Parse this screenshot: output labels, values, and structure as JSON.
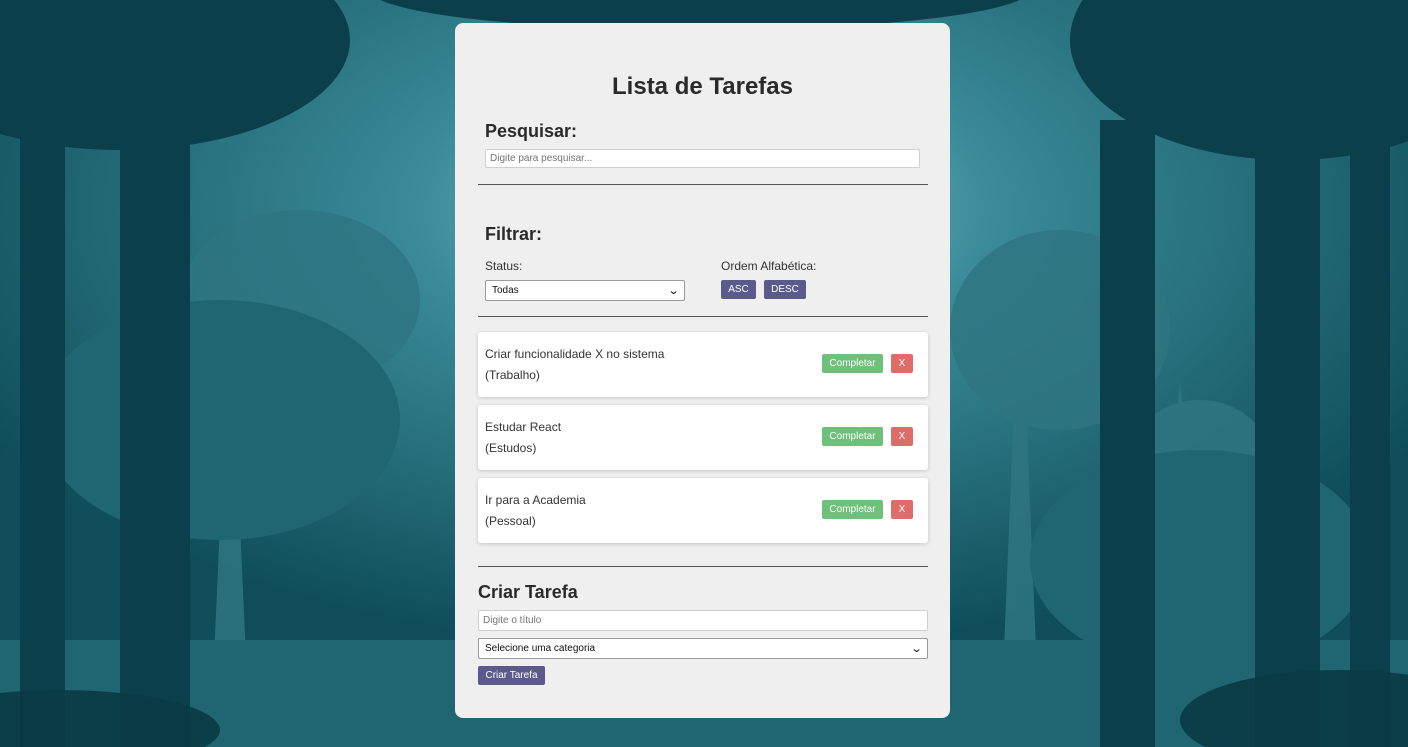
{
  "app": {
    "title": "Lista de Tarefas"
  },
  "search": {
    "heading": "Pesquisar:",
    "placeholder": "Digite para pesquisar..."
  },
  "filter": {
    "heading": "Filtrar:",
    "status_label": "Status:",
    "status_value": "Todas",
    "sort_label": "Ordem Alfabética:",
    "asc_label": "ASC",
    "desc_label": "DESC"
  },
  "tasks": [
    {
      "title": "Criar funcionalidade X no sistema",
      "category": "(Trabalho)",
      "complete_label": "Completar",
      "remove_label": "X"
    },
    {
      "title": "Estudar React",
      "category": "(Estudos)",
      "complete_label": "Completar",
      "remove_label": "X"
    },
    {
      "title": "Ir para a Academia",
      "category": "(Pessoal)",
      "complete_label": "Completar",
      "remove_label": "X"
    }
  ],
  "create": {
    "heading": "Criar Tarefa",
    "title_placeholder": "Digite o título",
    "category_value": "Selecione uma categoria",
    "submit_label": "Criar Tarefa"
  },
  "colors": {
    "panel": "#efefef",
    "primary_button": "#5b5a8c",
    "complete_button": "#6fc07a",
    "remove_button": "#e06b6b",
    "background": "#0d4a57"
  }
}
